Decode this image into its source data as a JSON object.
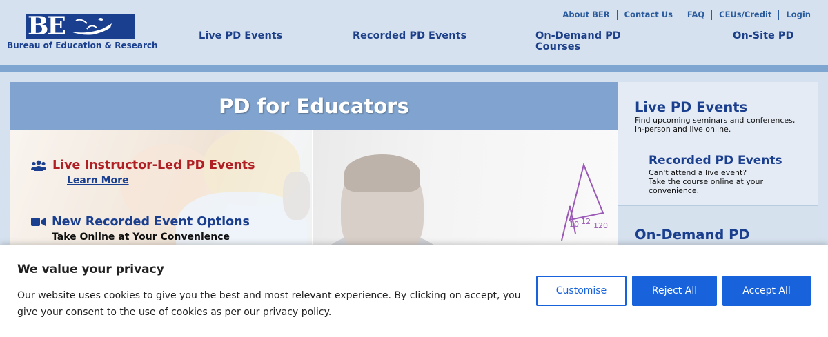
{
  "header": {
    "logo_text": "BER",
    "logo_subtitle": "Bureau of Education & Research",
    "utility_nav": [
      "About BER",
      "Contact Us",
      "FAQ",
      "CEUs/Credit",
      "Login"
    ],
    "main_nav": {
      "live": "Live PD Events",
      "recorded": "Recorded PD Events",
      "on_demand_line1": "On-Demand PD",
      "on_demand_line2": "Courses",
      "on_site": "On-Site PD"
    }
  },
  "hero": {
    "title": "PD for Educators",
    "feature1": {
      "icon": "users-icon",
      "title": "Live Instructor-Led PD Events",
      "link": "Learn More"
    },
    "feature2": {
      "icon": "video-camera-icon",
      "title": "New Recorded Event Options",
      "subtitle": "Take Online at Your Convenience"
    },
    "whiteboard_marks": [
      "10",
      "12",
      "120"
    ]
  },
  "sidebar": {
    "live": {
      "title": "Live PD Events",
      "line1": "Find upcoming seminars and conferences,",
      "line2": "in-person and live online."
    },
    "recorded": {
      "title": "Recorded PD Events",
      "line1": "Can't attend a live event?",
      "line2": "Take the course online at your",
      "line3": "convenience."
    },
    "on_demand": {
      "title": "On-Demand PD"
    }
  },
  "cookie_banner": {
    "title": "We value your privacy",
    "text": "Our website uses cookies to give you the best and most relevant experience. By clicking on accept, you give your consent to the use of cookies as per our privacy policy.",
    "customise": "Customise",
    "reject": "Reject All",
    "accept": "Accept All"
  },
  "colors": {
    "brand_navy": "#1b3f8f",
    "header_bg": "#d5e1ee",
    "hero_bar": "#80a4cf",
    "feature_red": "#b01f24",
    "button_blue": "#1863dc"
  }
}
